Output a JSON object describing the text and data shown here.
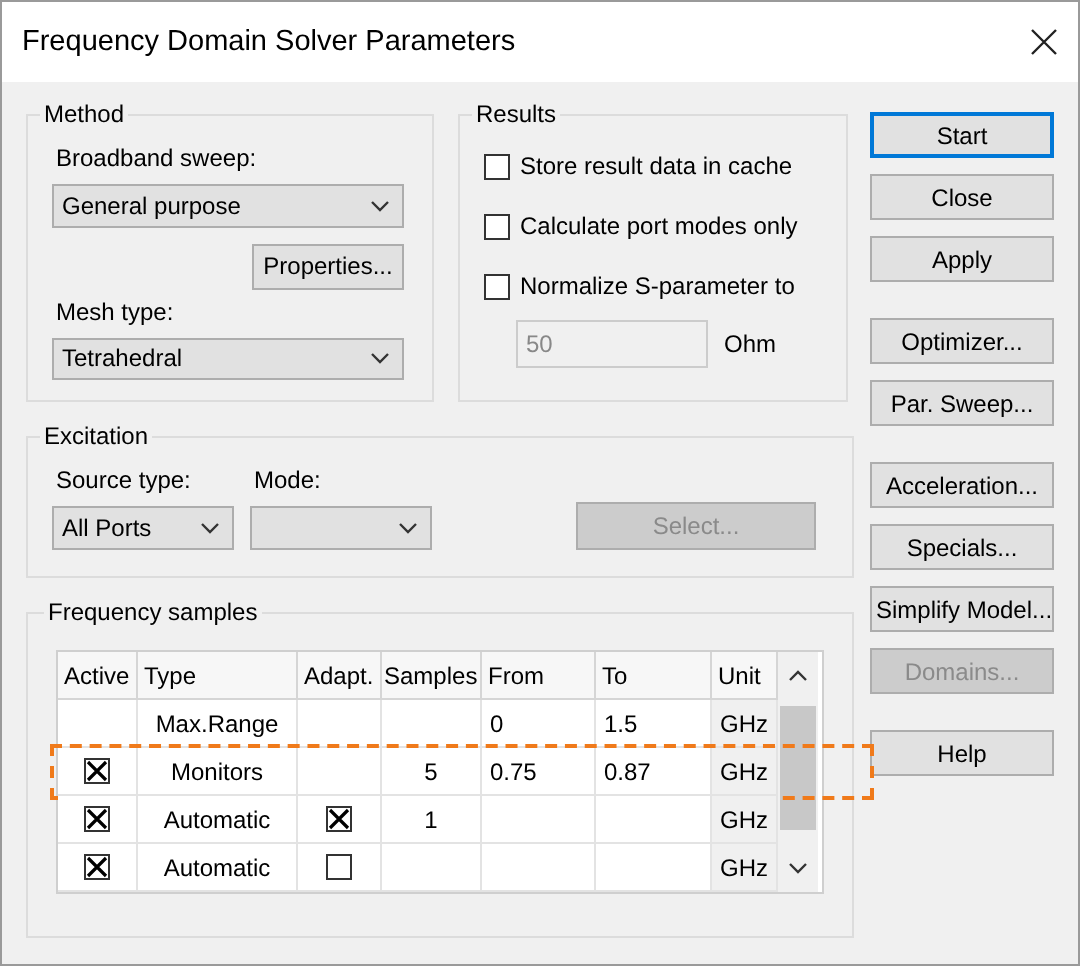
{
  "window": {
    "title": "Frequency Domain Solver Parameters"
  },
  "method": {
    "title": "Method",
    "broadband_label": "Broadband sweep:",
    "broadband_value": "General purpose",
    "properties_button": "Properties...",
    "mesh_label": "Mesh type:",
    "mesh_value": "Tetrahedral"
  },
  "results": {
    "title": "Results",
    "options": [
      {
        "label": "Store result data in cache",
        "checked": false
      },
      {
        "label": "Calculate port modes only",
        "checked": false
      },
      {
        "label": "Normalize S-parameter to",
        "checked": false
      }
    ],
    "impedance": {
      "value": "50",
      "unit": "Ohm",
      "disabled": true
    }
  },
  "excitation": {
    "title": "Excitation",
    "source_label": "Source type:",
    "source_value": "All Ports",
    "mode_label": "Mode:",
    "select_button": {
      "label": "Select...",
      "disabled": true
    }
  },
  "frequency_samples": {
    "title": "Frequency samples",
    "columns": [
      "Active",
      "Type",
      "Adapt.",
      "Samples",
      "From",
      "To",
      "Unit"
    ],
    "rows": [
      {
        "type": "Max.Range",
        "from": "0",
        "to": "1.5",
        "unit": "GHz",
        "highlighted": false
      },
      {
        "active": {
          "checked": true
        },
        "type": "Monitors",
        "samples": "5",
        "from": "0.75",
        "to": "0.87",
        "unit": "GHz",
        "highlighted": true
      },
      {
        "active": {
          "checked": true
        },
        "type": "Automatic",
        "adapt": {
          "checked": true
        },
        "samples": "1",
        "unit": "GHz",
        "highlighted": false
      },
      {
        "active": {
          "checked": true
        },
        "type": "Automatic",
        "adapt": {
          "checked": false
        },
        "unit": "GHz",
        "highlighted": false
      }
    ]
  },
  "button_groups": [
    [
      {
        "label": "Start",
        "default": true,
        "disabled": false
      },
      {
        "label": "Close",
        "default": false,
        "disabled": false
      },
      {
        "label": "Apply",
        "default": false,
        "disabled": false
      }
    ],
    [
      {
        "label": "Optimizer...",
        "default": false,
        "disabled": false
      },
      {
        "label": "Par. Sweep...",
        "default": false,
        "disabled": false
      }
    ],
    [
      {
        "label": "Acceleration...",
        "default": false,
        "disabled": false
      },
      {
        "label": "Specials...",
        "default": false,
        "disabled": false
      },
      {
        "label": "Simplify Model...",
        "default": false,
        "disabled": false
      },
      {
        "label": "Domains...",
        "default": false,
        "disabled": true
      }
    ],
    [
      {
        "label": "Help",
        "default": false,
        "disabled": false
      }
    ]
  ]
}
